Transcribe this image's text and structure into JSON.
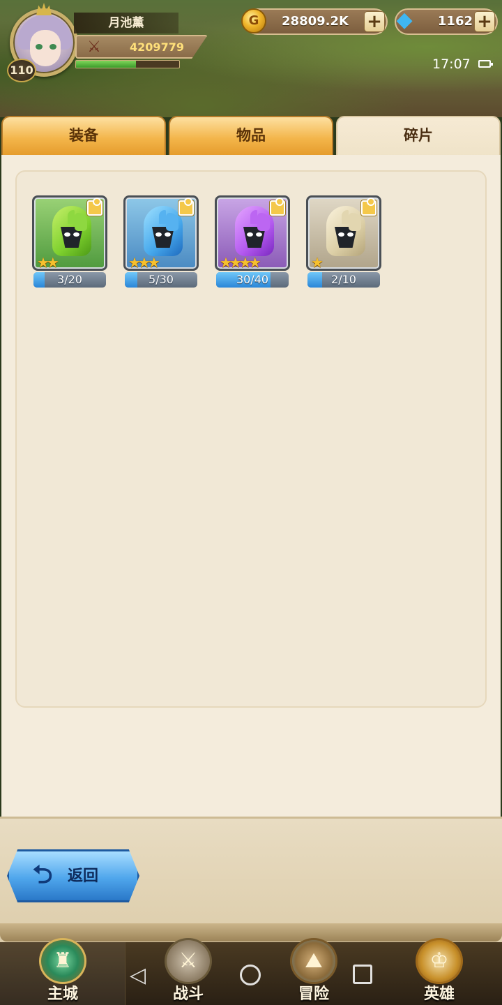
{
  "player": {
    "name": "月池薰",
    "level": "110",
    "power": "4209779",
    "exp_progress": 0.58
  },
  "resources": {
    "gold": "28809.2K",
    "gems": "1162",
    "plus": "+"
  },
  "status": {
    "time": "17:07"
  },
  "tabs": [
    {
      "label": "装备",
      "active": false
    },
    {
      "label": "物品",
      "active": false
    },
    {
      "label": "碎片",
      "active": true
    }
  ],
  "fragments": [
    {
      "icon": "green-helmet-icon",
      "color": "green",
      "stars": "★★",
      "count": "3/20",
      "progress": 0.15
    },
    {
      "icon": "blue-helmet-icon",
      "color": "blue",
      "stars": "★★★",
      "count": "5/30",
      "progress": 0.17
    },
    {
      "icon": "purple-helmet-icon",
      "color": "purple",
      "stars": "★★★★",
      "count": "30/40",
      "progress": 0.75
    },
    {
      "icon": "white-helmet-icon",
      "color": "white",
      "stars": "★",
      "count": "2/10",
      "progress": 0.2
    }
  ],
  "back_button": {
    "label": "返回",
    "icon": "⮌"
  },
  "bottom_nav": [
    {
      "label": "主城",
      "icon": "castle-icon",
      "glyph": "♜"
    },
    {
      "label": "战斗",
      "icon": "crossed-swords-icon",
      "glyph": "⚔"
    },
    {
      "label": "冒险",
      "icon": "map-scroll-icon",
      "glyph": "⛰"
    },
    {
      "label": "英雄",
      "icon": "hero-crest-icon",
      "glyph": "♔"
    }
  ],
  "system_nav": {
    "back": "◁"
  },
  "colors": {
    "tab_inactive": "#f3b54a",
    "tab_active": "#efe3c8",
    "paper": "#f4ecdc",
    "back_button": "#4fa6ec",
    "progress_fill": "#2a86d8"
  }
}
